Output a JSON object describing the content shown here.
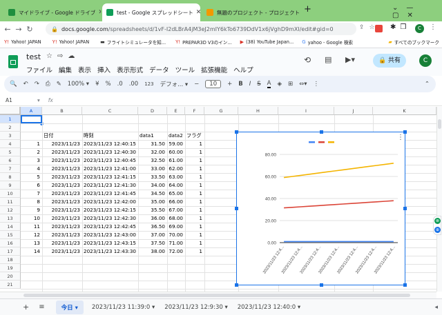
{
  "browser": {
    "tabs": [
      {
        "title": "マイドライブ - Google ドライブ",
        "fav": "#1e8e3e"
      },
      {
        "title": "test - Google スプレッドシート",
        "fav": "#0f9d58"
      },
      {
        "title": "無題のプロジェクト - プロジェクト編集",
        "fav": "#f29900"
      }
    ],
    "url_host": "docs.google.com",
    "url_path": "/spreadsheets/d/1vF-I2dLBrA4jM3eJ2mIY6kTo6739DdV1x6jVghD9mXI/edit#gid=0",
    "bookmarks": [
      "Yahoo! JAPAN",
      "Yahoo! JAPAN",
      "フライトシミュレータを知...",
      "PREPAR3D V3のイン...",
      "(38) YouTube Japan...",
      "yahoo - Google 検索"
    ],
    "bookmarks_more": "すべてのブックマーク"
  },
  "doc": {
    "title": "test",
    "share": "共有",
    "avatar": "C",
    "menu": [
      "ファイル",
      "編集",
      "表示",
      "挿入",
      "表示形式",
      "データ",
      "ツール",
      "拡張機能",
      "ヘルプ"
    ]
  },
  "toolbar": {
    "zoom": "100%",
    "currency": "¥",
    "percent": "%",
    "dec_down": ".0",
    "dec_up": ".00",
    "fmt123": "123",
    "font": "デフォ...",
    "font_size": "10",
    "bold": "B",
    "italic": "I",
    "strike": "S",
    "underline_a": "A"
  },
  "formula": {
    "cell_ref": "A1",
    "fx": "fx"
  },
  "columns": [
    "A",
    "B",
    "C",
    "D",
    "E",
    "F",
    "G",
    "H",
    "I",
    "J",
    "K"
  ],
  "rows": [
    "1",
    "2",
    "3",
    "4",
    "5",
    "6",
    "7",
    "8",
    "9",
    "10",
    "11",
    "12",
    "13",
    "14",
    "15",
    "16",
    "17",
    "18",
    "19",
    "20",
    "21"
  ],
  "table": {
    "headers": [
      "日付",
      "時刻",
      "data1",
      "data2",
      "フラグ"
    ],
    "data": [
      [
        "1",
        "2023/11/23",
        "2023/11/23 12:40:15",
        "31.50",
        "59.00",
        "1"
      ],
      [
        "2",
        "2023/11/23",
        "2023/11/23 12:40:30",
        "32.00",
        "60.00",
        "1"
      ],
      [
        "3",
        "2023/11/23",
        "2023/11/23 12:40:45",
        "32.50",
        "61.00",
        "1"
      ],
      [
        "4",
        "2023/11/23",
        "2023/11/23 12:41:00",
        "33.00",
        "62.00",
        "1"
      ],
      [
        "5",
        "2023/11/23",
        "2023/11/23 12:41:15",
        "33.50",
        "63.00",
        "1"
      ],
      [
        "6",
        "2023/11/23",
        "2023/11/23 12:41:30",
        "34.00",
        "64.00",
        "1"
      ],
      [
        "7",
        "2023/11/23",
        "2023/11/23 12:41:45",
        "34.50",
        "65.00",
        "1"
      ],
      [
        "8",
        "2023/11/23",
        "2023/11/23 12:42:00",
        "35.00",
        "66.00",
        "1"
      ],
      [
        "9",
        "2023/11/23",
        "2023/11/23 12:42:15",
        "35.50",
        "67.00",
        "1"
      ],
      [
        "10",
        "2023/11/23",
        "2023/11/23 12:42:30",
        "36.00",
        "68.00",
        "1"
      ],
      [
        "11",
        "2023/11/23",
        "2023/11/23 12:42:45",
        "36.50",
        "69.00",
        "1"
      ],
      [
        "12",
        "2023/11/23",
        "2023/11/23 12:43:00",
        "37.00",
        "70.00",
        "1"
      ],
      [
        "13",
        "2023/11/23",
        "2023/11/23 12:43:15",
        "37.50",
        "71.00",
        "1"
      ],
      [
        "14",
        "2023/11/23",
        "2023/11/23 12:43:30",
        "38.00",
        "72.00",
        "1"
      ]
    ]
  },
  "chart_data": {
    "type": "line",
    "title": "",
    "x_tick_labels": [
      "2023/11/23 12:4...",
      "2023/11/23 12:4...",
      "2023/11/23 12:4...",
      "2023/11/23 12:4...",
      "2023/11/23 12:4...",
      "2023/11/23 12:4...",
      "2023/11/23 12:4..."
    ],
    "ylim": [
      0,
      80
    ],
    "yticks": [
      "0.00",
      "20.00",
      "40.00",
      "60.00",
      "80.00"
    ],
    "series": [
      {
        "key": "flag",
        "color": "#4285f4",
        "values": [
          1,
          1,
          1,
          1,
          1,
          1,
          1,
          1,
          1,
          1,
          1,
          1,
          1,
          1
        ]
      },
      {
        "key": "data1",
        "color": "#db4437",
        "values": [
          31.5,
          32,
          32.5,
          33,
          33.5,
          34,
          34.5,
          35,
          35.5,
          36,
          36.5,
          37,
          37.5,
          38
        ]
      },
      {
        "key": "data2",
        "color": "#f4b400",
        "values": [
          59,
          60,
          61,
          62,
          63,
          64,
          65,
          66,
          67,
          68,
          69,
          70,
          71,
          72
        ]
      }
    ],
    "legend_position": "top",
    "grid": true
  },
  "sheets": {
    "active": "今日",
    "others": [
      "2023/11/23 11:39:0",
      "2023/11/23 12:9:30",
      "2023/11/23 12:40:0"
    ]
  }
}
